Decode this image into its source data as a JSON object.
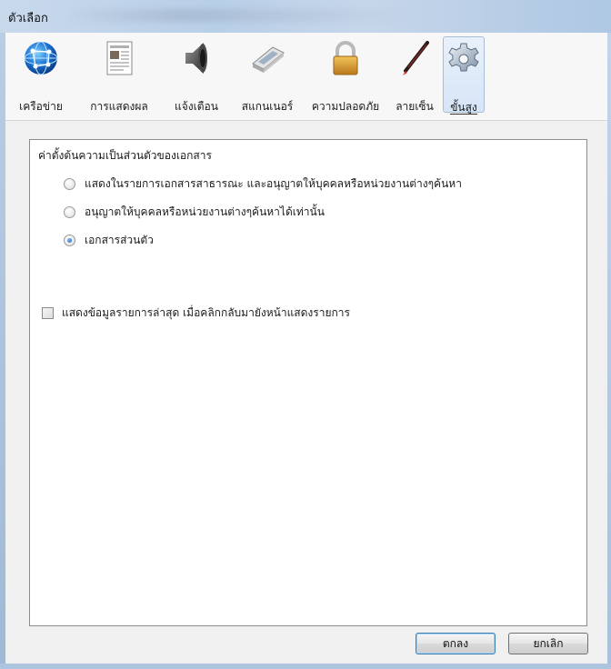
{
  "window": {
    "title": "ตัวเลือก"
  },
  "toolbar": {
    "items": [
      {
        "label": "เครือข่าย",
        "icon": "network-globe-icon"
      },
      {
        "label": "การแสดงผล",
        "icon": "display-document-icon"
      },
      {
        "label": "แจ้งเตือน",
        "icon": "speaker-icon"
      },
      {
        "label": "สแกนเนอร์",
        "icon": "scanner-icon"
      },
      {
        "label": "ความปลอดภัย",
        "icon": "padlock-icon"
      },
      {
        "label": "ลายเซ็น",
        "icon": "pen-icon"
      },
      {
        "label": "ขั้นสูง",
        "icon": "gear-icon",
        "selected": true
      }
    ]
  },
  "privacy": {
    "heading": "ค่าตั้งต้นความเป็นส่วนตัวของเอกสาร",
    "options": [
      {
        "label": "แสดงในรายการเอกสารสาธารณะ และอนุญาตให้บุคคลหรือหน่วยงานต่างๆค้นหา",
        "checked": false
      },
      {
        "label": "อนุญาตให้บุคคลหรือหน่วยงานต่างๆค้นหาได้เท่านั้น",
        "checked": false
      },
      {
        "label": "เอกสารส่วนตัว",
        "checked": true
      }
    ]
  },
  "recent": {
    "label": "แสดงข้อมูลรายการล่าสุด เมื่อคลิกกลับมายังหน้าแสดงรายการ",
    "checked": false
  },
  "buttons": {
    "ok": "ตกลง",
    "cancel": "ยกเลิก"
  }
}
